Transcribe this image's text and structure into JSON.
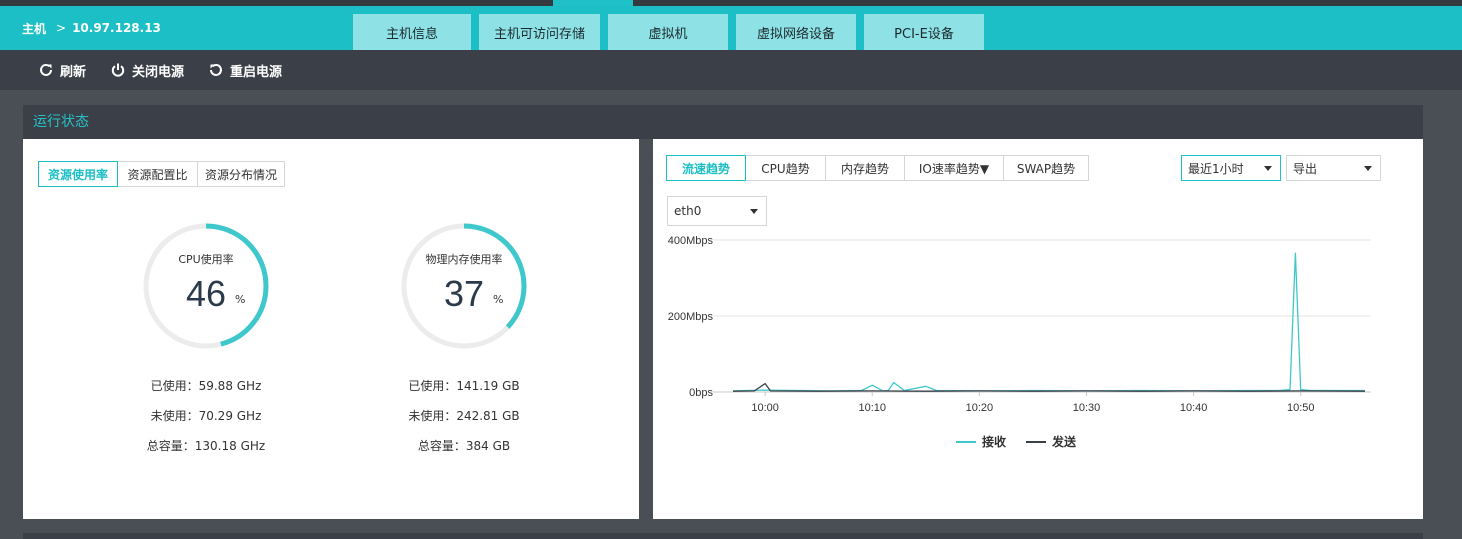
{
  "breadcrumb": {
    "root": "主机",
    "separator": ">",
    "host": "10.97.128.13"
  },
  "tabs": [
    {
      "label": "主机信息",
      "active": true
    },
    {
      "label": "主机可访问存储",
      "active": false
    },
    {
      "label": "虚拟机",
      "active": false
    },
    {
      "label": "虚拟网络设备",
      "active": false
    },
    {
      "label": "PCI-E设备",
      "active": false
    }
  ],
  "toolbar": {
    "refresh": "刷新",
    "power_off": "关闭电源",
    "restart": "重启电源"
  },
  "section": {
    "title": "运行状态"
  },
  "left_tabs": [
    {
      "label": "资源使用率",
      "active": true
    },
    {
      "label": "资源配置比",
      "active": false
    },
    {
      "label": "资源分布情况",
      "active": false
    }
  ],
  "gauges": [
    {
      "label": "CPU使用率",
      "value": "46",
      "unit": "%",
      "percent": 46,
      "used": "已使用：59.88 GHz",
      "free": "未使用：70.29 GHz",
      "total": "总容量：130.18 GHz"
    },
    {
      "label": "物理内存使用率",
      "value": "37",
      "unit": "%",
      "percent": 37,
      "used": "已使用：141.19 GB",
      "free": "未使用：242.81 GB",
      "total": "总容量：384 GB"
    }
  ],
  "right_tabs": [
    {
      "label": "流速趋势",
      "active": true
    },
    {
      "label": "CPU趋势",
      "active": false
    },
    {
      "label": "内存趋势",
      "active": false
    },
    {
      "label": "IO速率趋势▼",
      "active": false
    },
    {
      "label": "SWAP趋势",
      "active": false
    }
  ],
  "time_range": "最近1小时",
  "export_label": "导出",
  "interface": "eth0",
  "colors": {
    "accent": "#1cbfc5",
    "receive": "#3fc8cb",
    "send": "#3b4048",
    "dark": "#3b4048"
  },
  "chart_data": {
    "type": "line",
    "ylabel": "",
    "xlabel": "",
    "y_ticks": [
      "0bps",
      "200Mbps",
      "400Mbps"
    ],
    "ylim": [
      0,
      400
    ],
    "y_unit": "Mbps",
    "x_ticks": [
      "10:00",
      "10:10",
      "10:20",
      "10:30",
      "10:40",
      "10:50"
    ],
    "xlim": [
      "09:57",
      "10:56"
    ],
    "legend": [
      "接收",
      "发送"
    ],
    "legend_position": "bottom",
    "grid": true,
    "series": [
      {
        "name": "接收",
        "color": "#3fc8cb",
        "points": [
          [
            "09:57",
            3
          ],
          [
            "10:00",
            5
          ],
          [
            "10:03",
            4
          ],
          [
            "10:06",
            3
          ],
          [
            "10:09",
            4
          ],
          [
            "10:10",
            18
          ],
          [
            "10:11",
            3
          ],
          [
            "10:11:30",
            4
          ],
          [
            "10:12",
            25
          ],
          [
            "10:13",
            4
          ],
          [
            "10:15",
            15
          ],
          [
            "10:16",
            4
          ],
          [
            "10:20",
            3
          ],
          [
            "10:25",
            4
          ],
          [
            "10:30",
            3
          ],
          [
            "10:35",
            4
          ],
          [
            "10:40",
            3
          ],
          [
            "10:45",
            4
          ],
          [
            "10:48",
            4
          ],
          [
            "10:49",
            6
          ],
          [
            "10:49:30",
            365
          ],
          [
            "10:50",
            6
          ],
          [
            "10:51",
            4
          ],
          [
            "10:56",
            4
          ]
        ]
      },
      {
        "name": "发送",
        "color": "#3b4048",
        "points": [
          [
            "09:57",
            2
          ],
          [
            "09:59",
            3
          ],
          [
            "10:00",
            22
          ],
          [
            "10:00:30",
            3
          ],
          [
            "10:05",
            2
          ],
          [
            "10:10",
            3
          ],
          [
            "10:15",
            2
          ],
          [
            "10:20",
            3
          ],
          [
            "10:25",
            2
          ],
          [
            "10:30",
            3
          ],
          [
            "10:35",
            2
          ],
          [
            "10:40",
            3
          ],
          [
            "10:45",
            2
          ],
          [
            "10:50",
            3
          ],
          [
            "10:56",
            2
          ]
        ]
      }
    ]
  }
}
